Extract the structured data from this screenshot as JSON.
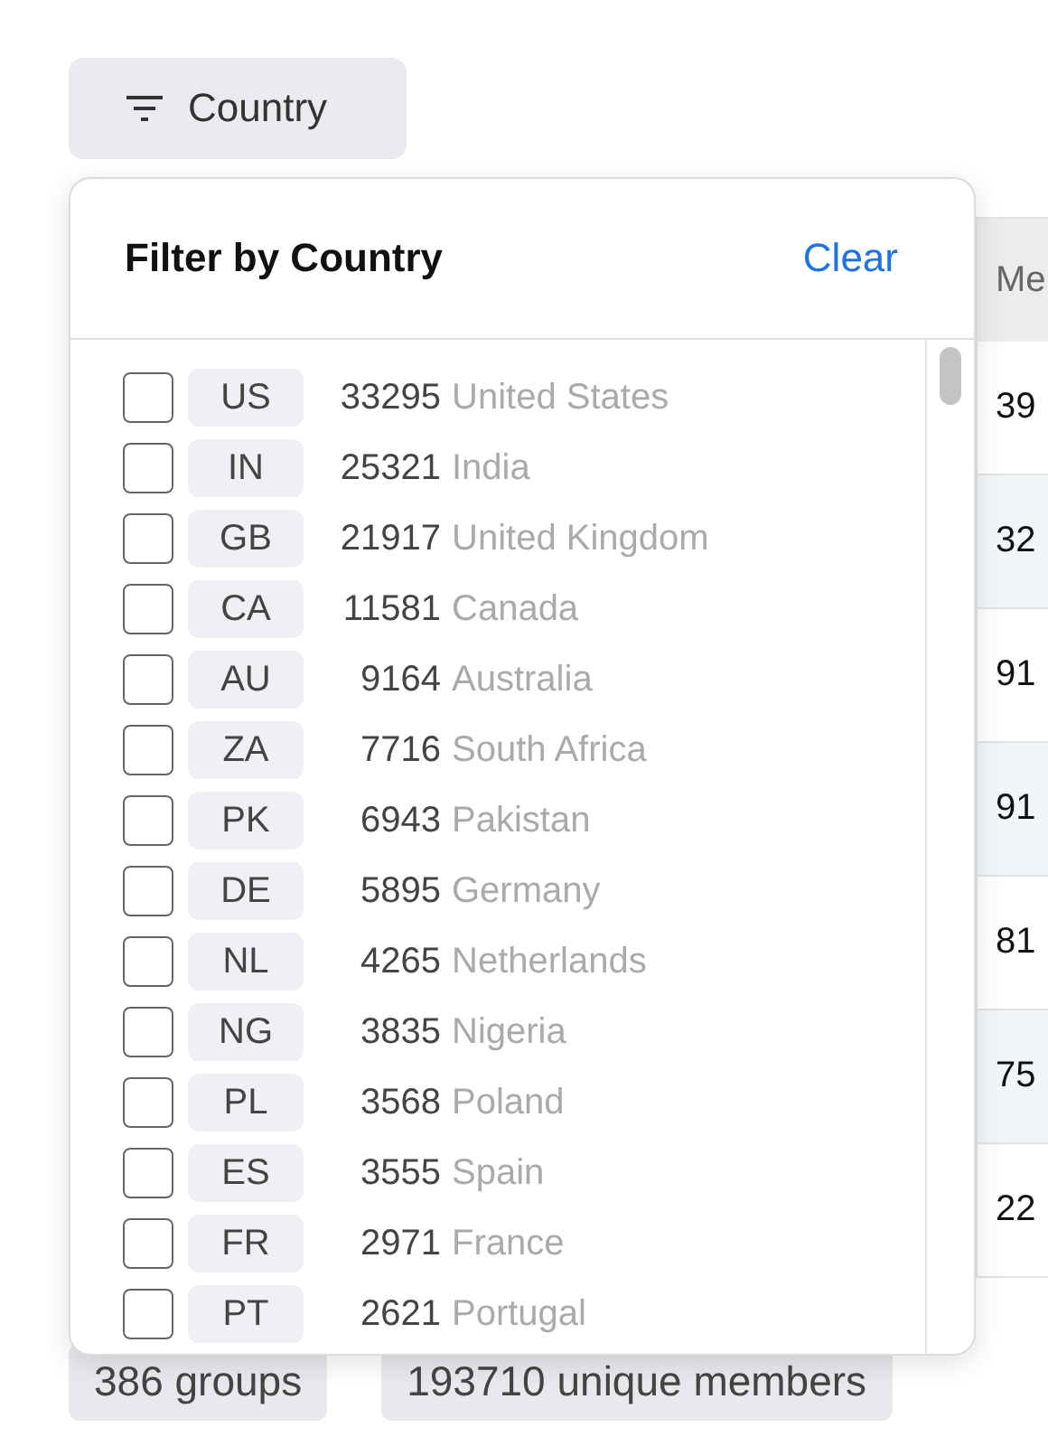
{
  "filter_button": {
    "label": "Country"
  },
  "table": {
    "columns": [
      "Me"
    ],
    "rows": [
      {
        "cells": [
          "39"
        ]
      },
      {
        "cells": [
          "32"
        ]
      },
      {
        "cells": [
          "91"
        ]
      },
      {
        "cells": [
          "91"
        ]
      },
      {
        "cells": [
          "81"
        ]
      },
      {
        "cells": [
          "75"
        ]
      },
      {
        "cells": [
          "22"
        ]
      }
    ]
  },
  "summary": [
    "386 groups",
    "193710 unique members"
  ],
  "dropdown": {
    "title": "Filter by Country",
    "clear": "Clear",
    "options": [
      {
        "code": "US",
        "count": "33295",
        "name": "United States",
        "checked": false
      },
      {
        "code": "IN",
        "count": "25321",
        "name": "India",
        "checked": false
      },
      {
        "code": "GB",
        "count": "21917",
        "name": "United Kingdom",
        "checked": false
      },
      {
        "code": "CA",
        "count": "11581",
        "name": "Canada",
        "checked": false
      },
      {
        "code": "AU",
        "count": "9164",
        "name": "Australia",
        "checked": false
      },
      {
        "code": "ZA",
        "count": "7716",
        "name": "South Africa",
        "checked": false
      },
      {
        "code": "PK",
        "count": "6943",
        "name": "Pakistan",
        "checked": false
      },
      {
        "code": "DE",
        "count": "5895",
        "name": "Germany",
        "checked": false
      },
      {
        "code": "NL",
        "count": "4265",
        "name": "Netherlands",
        "checked": false
      },
      {
        "code": "NG",
        "count": "3835",
        "name": "Nigeria",
        "checked": false
      },
      {
        "code": "PL",
        "count": "3568",
        "name": "Poland",
        "checked": false
      },
      {
        "code": "ES",
        "count": "3555",
        "name": "Spain",
        "checked": false
      },
      {
        "code": "FR",
        "count": "2971",
        "name": "France",
        "checked": false
      },
      {
        "code": "PT",
        "count": "2621",
        "name": "Portugal",
        "checked": false
      }
    ]
  }
}
